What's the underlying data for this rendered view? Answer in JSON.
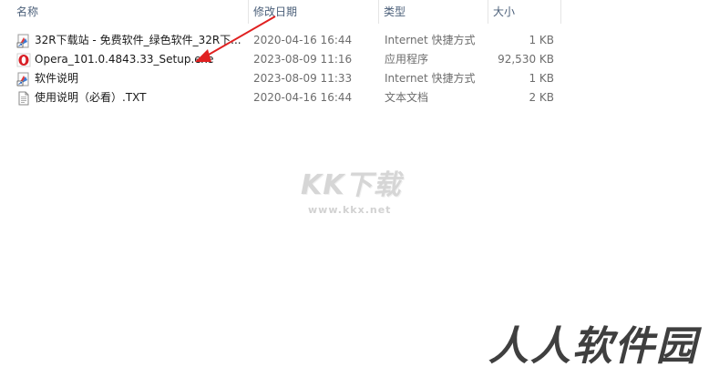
{
  "columns": {
    "name": "名称",
    "date": "修改日期",
    "type": "类型",
    "size": "大小"
  },
  "files": [
    {
      "name": "32R下载站 - 免费软件_绿色软件_32R下...",
      "date": "2020-04-16 16:44",
      "type": "Internet 快捷方式",
      "size": "1 KB",
      "icon": "internet-shortcut-icon"
    },
    {
      "name": "Opera_101.0.4843.33_Setup.exe",
      "date": "2023-08-09 11:16",
      "type": "应用程序",
      "size": "92,530 KB",
      "icon": "opera-icon"
    },
    {
      "name": "软件说明",
      "date": "2023-08-09 11:33",
      "type": "Internet 快捷方式",
      "size": "1 KB",
      "icon": "internet-shortcut-icon"
    },
    {
      "name": "使用说明（必看）.TXT",
      "date": "2020-04-16 16:44",
      "type": "文本文档",
      "size": "2 KB",
      "icon": "text-document-icon"
    }
  ],
  "watermarks": {
    "logo": "KK下载",
    "url": "www.kkx.net",
    "brand": "人人软件园"
  },
  "colors": {
    "annotation_arrow": "#e02020",
    "opera_red": "#d81f26",
    "header_text": "#4c607a"
  }
}
